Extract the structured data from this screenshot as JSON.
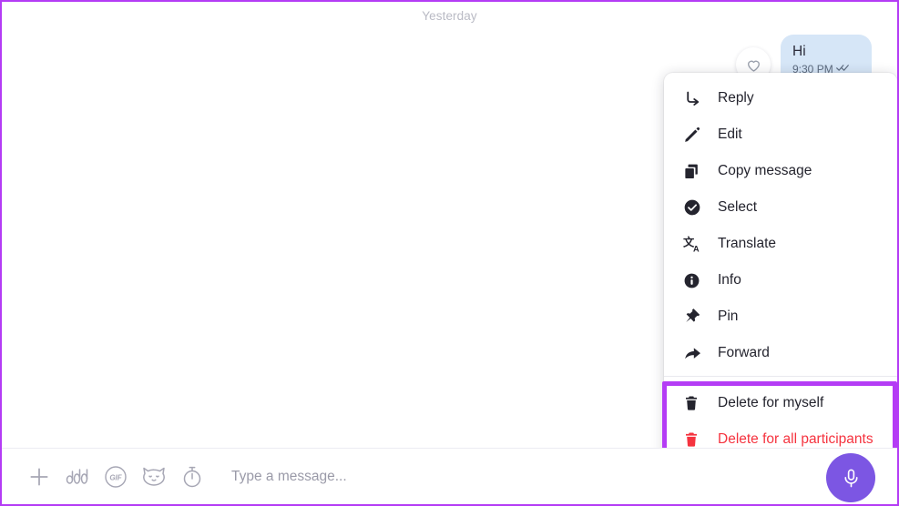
{
  "window": {
    "accent_purple": "#7c56e3",
    "annotation_purple": "#b43cf5",
    "bubble_blue": "#d6e6f7",
    "delete_all_red": "#f5333f"
  },
  "chat": {
    "date_divider": "Yesterday",
    "message": {
      "text": "Hi",
      "time": "9:30 PM",
      "status_icon": "double-check-icon"
    },
    "reaction_icon": "heart-icon"
  },
  "context_menu": {
    "items": [
      {
        "label": "Reply",
        "icon": "reply-arrow-icon"
      },
      {
        "label": "Edit",
        "icon": "pencil-icon"
      },
      {
        "label": "Copy message",
        "icon": "copy-icon"
      },
      {
        "label": "Select",
        "icon": "check-circle-icon"
      },
      {
        "label": "Translate",
        "icon": "translate-icon"
      },
      {
        "label": "Info",
        "icon": "info-circle-icon"
      },
      {
        "label": "Pin",
        "icon": "pin-icon"
      },
      {
        "label": "Forward",
        "icon": "forward-arrow-icon"
      }
    ],
    "delete_items": [
      {
        "label": "Delete for myself",
        "icon": "trash-icon",
        "color": "#24242e"
      },
      {
        "label": "Delete for all participants",
        "icon": "trash-icon-red",
        "color": "#f5333f"
      }
    ]
  },
  "composer": {
    "placeholder": "Type a message...",
    "value": "",
    "icons": [
      {
        "name": "plus-icon",
        "label": "Add attachment"
      },
      {
        "name": "audio-bars-icon",
        "label": "Voice"
      },
      {
        "name": "gif-icon",
        "label": "GIF"
      },
      {
        "name": "sticker-icon",
        "label": "Sticker"
      },
      {
        "name": "timer-icon",
        "label": "Disappearing message timer"
      }
    ],
    "mic_icon": "microphone-icon"
  }
}
